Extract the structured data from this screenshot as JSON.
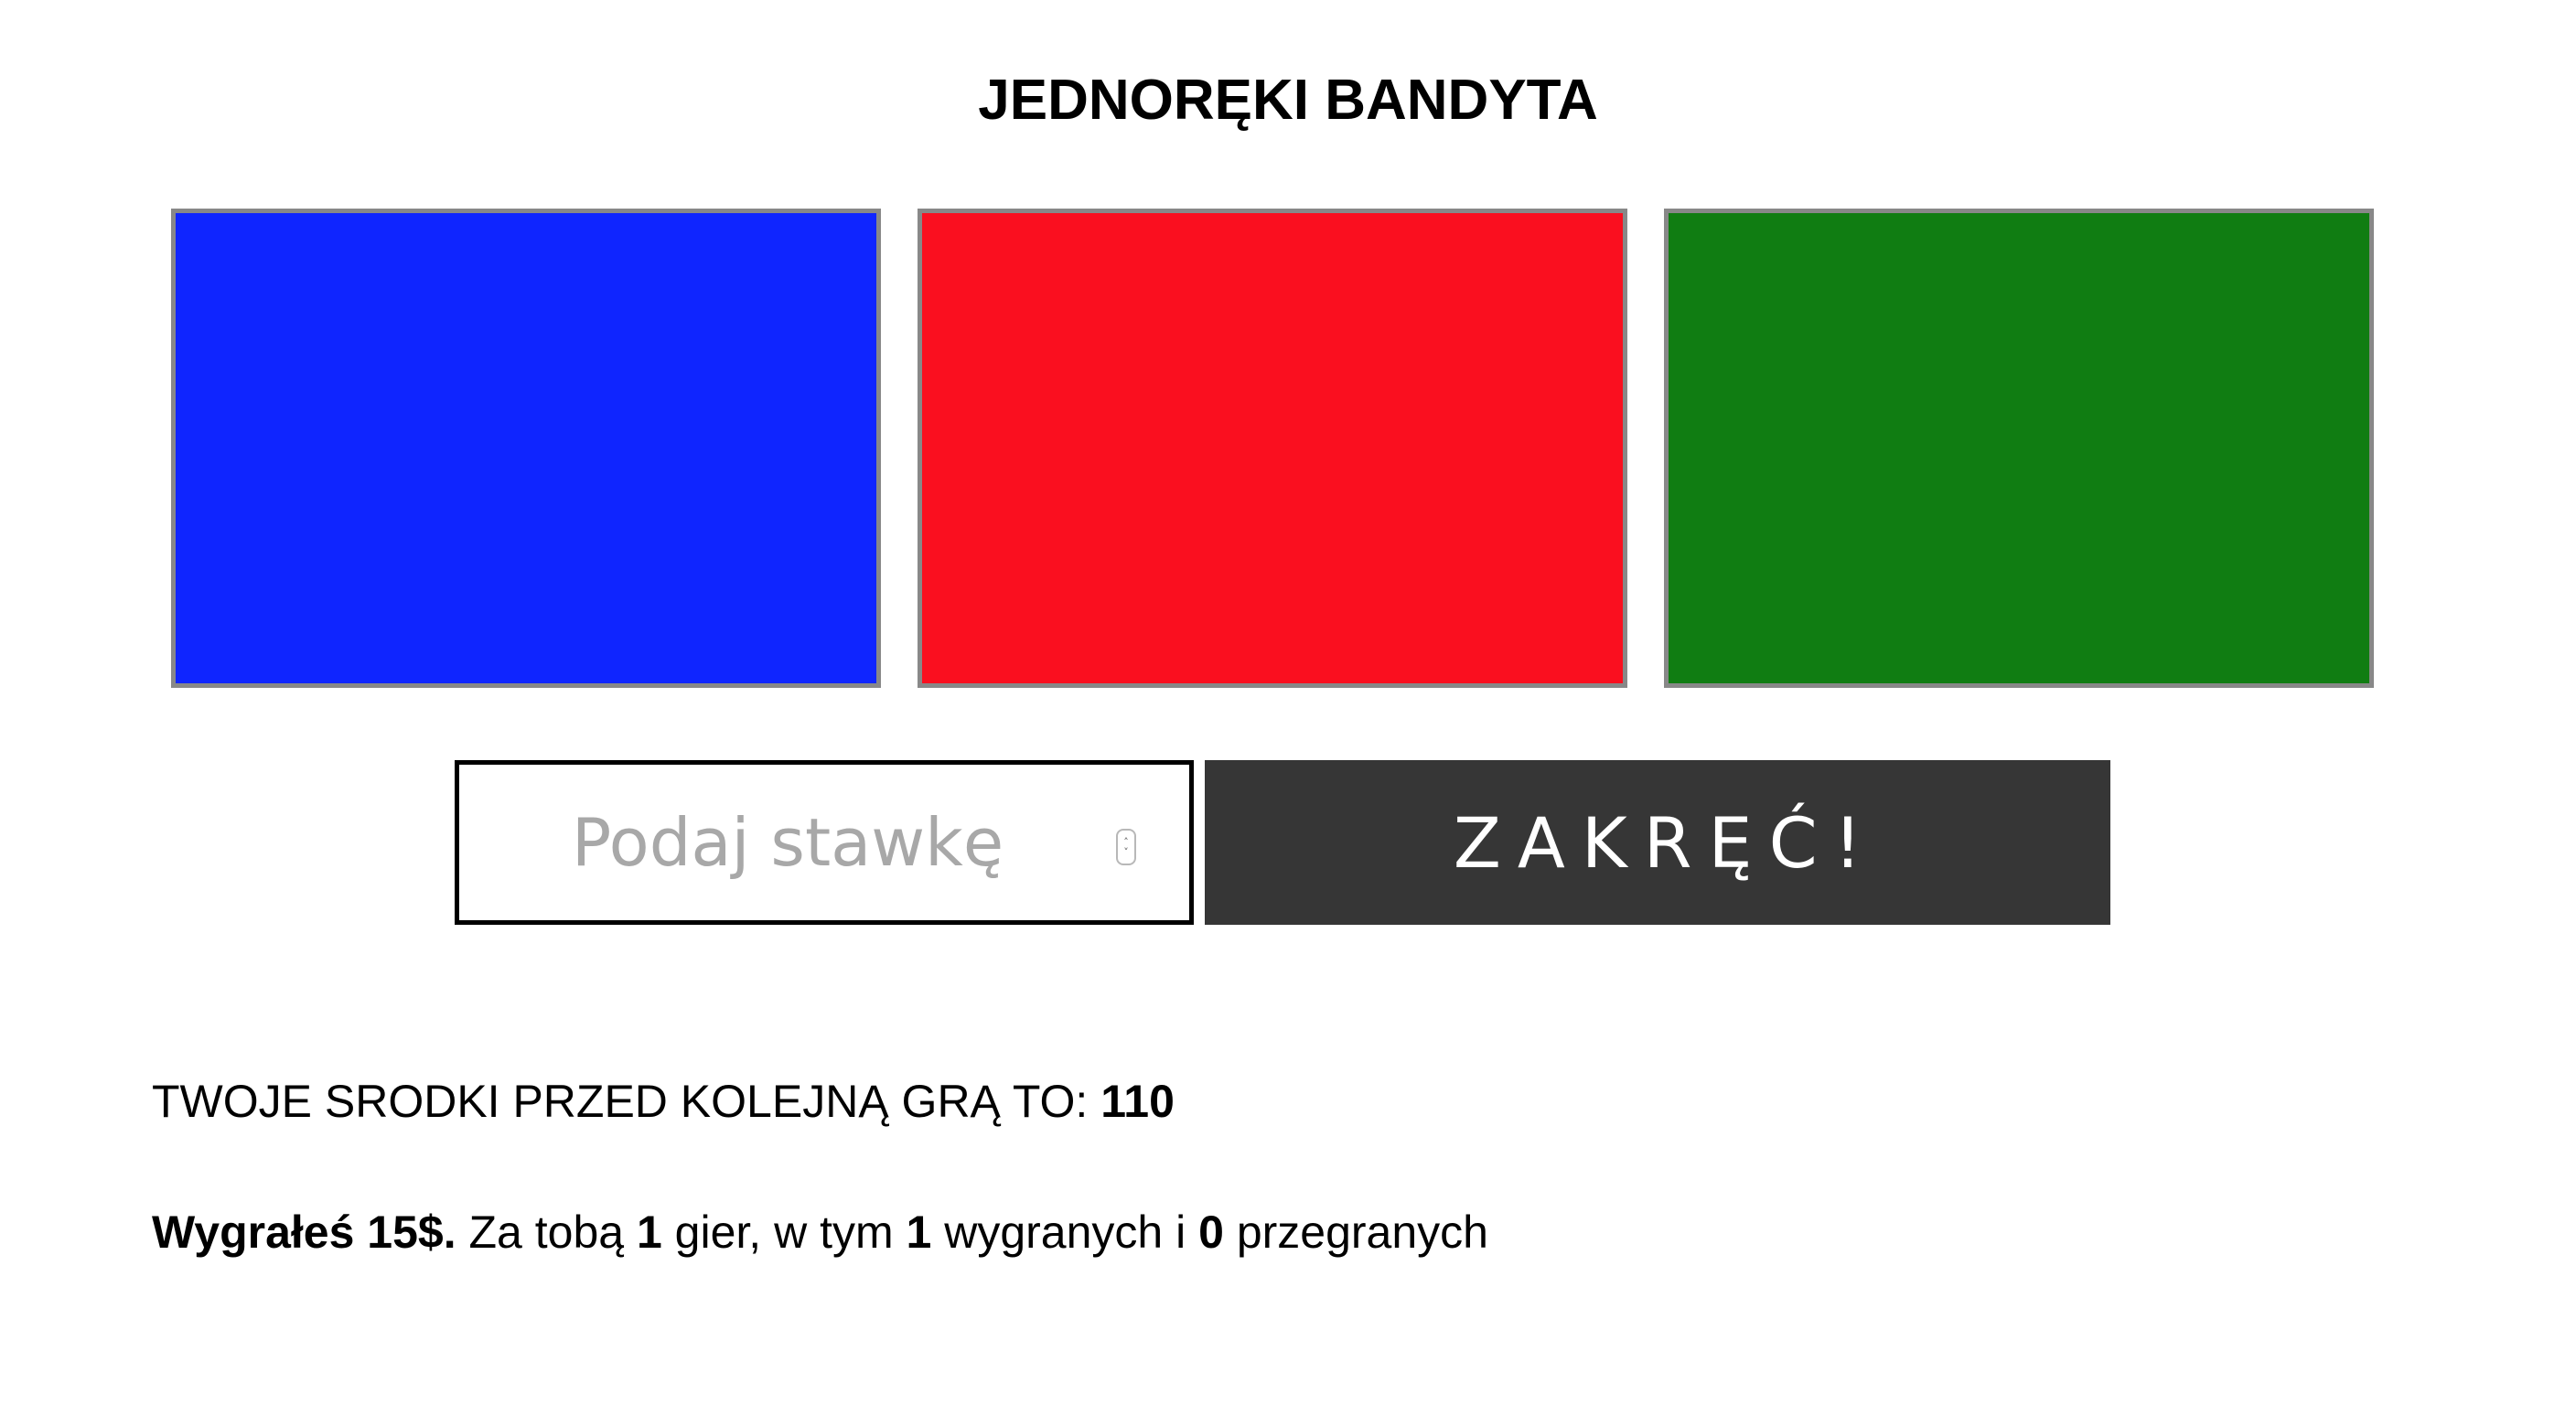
{
  "game": {
    "title": "JEDNORĘKI BANDYTA"
  },
  "reels": [
    {
      "color": "#0f25ff"
    },
    {
      "color": "#fa0f1f"
    },
    {
      "color": "#107d12"
    }
  ],
  "controls": {
    "stake_placeholder": "Podaj stawkę",
    "stake_value": "",
    "spin_label": "ZAKRĘĆ!",
    "spinner_up": "˄",
    "spinner_down": "˅"
  },
  "funds": {
    "label": "TWOJE SRODKI PRZED KOLEJNĄ GRĄ TO: ",
    "value": "110"
  },
  "stats": {
    "result_text": "Wygrałeś 15$.",
    "text1": " Za tobą ",
    "games": "1",
    "text2": " gier, w tym ",
    "wins": "1",
    "text3": " wygranych i ",
    "losses": "0",
    "text4": " przegranych"
  }
}
